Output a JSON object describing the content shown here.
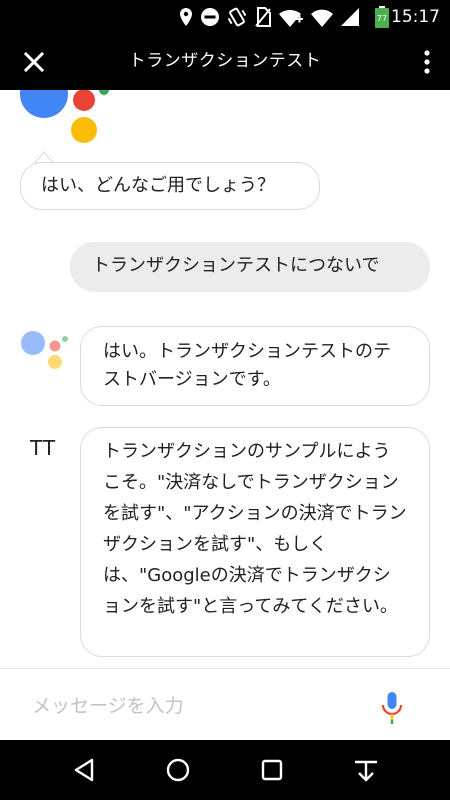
{
  "status_bar": {
    "time": "15:17",
    "battery_level": "77",
    "icons": [
      "location-icon",
      "do-not-disturb-icon",
      "vibrate-icon",
      "no-sim-icon",
      "wifi-calling-icon",
      "wifi-icon",
      "signal-icon",
      "battery-icon"
    ]
  },
  "app_bar": {
    "title": "トランザクションテスト",
    "close_icon": "close-icon",
    "menu_icon": "more-vert-icon"
  },
  "chat": {
    "messages": [
      {
        "sender": "assistant",
        "text": "はい、どんなご用でしょう？"
      },
      {
        "sender": "user",
        "text": "トランザクションテストにつないで"
      },
      {
        "sender": "assistant",
        "text": "はい。トランザクションテストのテストバージョンです。"
      },
      {
        "sender": "action",
        "avatar": "TT",
        "text": "トランザクションのサンプルにようこそ。\"決済なしでトランザクションを試す\"、\"アクションの決済でトランザクションを試す\"、もしくは、\"Googleの決済でトランザクションを試す\"と言ってみてください。"
      }
    ]
  },
  "input": {
    "placeholder": "メッセージを入力",
    "value": ""
  },
  "nav_bar": {
    "icons": [
      "back-icon",
      "home-icon",
      "recents-icon",
      "hide-keyboard-icon"
    ]
  },
  "colors": {
    "assistant_blue": "#4285F4",
    "assistant_red": "#EA4335",
    "assistant_yellow": "#FBBC05",
    "assistant_green": "#34A853",
    "user_bubble": "#ECECEC"
  }
}
